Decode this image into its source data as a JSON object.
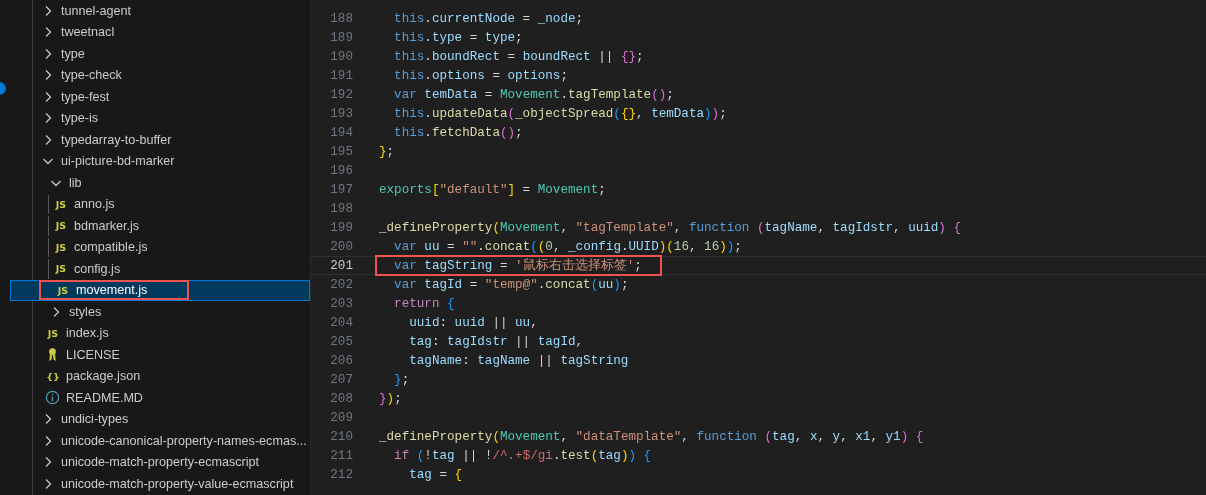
{
  "sidebar": {
    "tree": [
      {
        "label": "tunnel-agent",
        "kind": "folder",
        "expanded": false,
        "selected": false,
        "marked": false
      },
      {
        "label": "tweetnacl",
        "kind": "folder",
        "expanded": false,
        "selected": false,
        "marked": false
      },
      {
        "label": "type",
        "kind": "folder",
        "expanded": false,
        "selected": false,
        "marked": false
      },
      {
        "label": "type-check",
        "kind": "folder",
        "expanded": false,
        "selected": false,
        "marked": false
      },
      {
        "label": "type-fest",
        "kind": "folder",
        "expanded": false,
        "selected": false,
        "marked": false
      },
      {
        "label": "type-is",
        "kind": "folder",
        "expanded": false,
        "selected": false,
        "marked": false
      },
      {
        "label": "typedarray-to-buffer",
        "kind": "folder",
        "expanded": false,
        "selected": false,
        "marked": false
      },
      {
        "label": "ui-picture-bd-marker",
        "kind": "folder",
        "expanded": true,
        "selected": false,
        "marked": false,
        "children": [
          {
            "label": "lib",
            "kind": "folder",
            "expanded": true,
            "selected": false,
            "marked": false,
            "children": [
              {
                "label": "anno.js",
                "kind": "js",
                "badge": "JS",
                "selected": false,
                "marked": false
              },
              {
                "label": "bdmarker.js",
                "kind": "js",
                "badge": "JS",
                "selected": false,
                "marked": false
              },
              {
                "label": "compatible.js",
                "kind": "js",
                "badge": "JS",
                "selected": false,
                "marked": false
              },
              {
                "label": "config.js",
                "kind": "js",
                "badge": "JS",
                "selected": false,
                "marked": false
              },
              {
                "label": "movement.js",
                "kind": "js",
                "badge": "JS",
                "selected": true,
                "marked": true
              }
            ]
          },
          {
            "label": "styles",
            "kind": "folder",
            "expanded": false,
            "selected": false,
            "marked": false
          },
          {
            "label": "index.js",
            "kind": "js",
            "badge": "JS",
            "selected": false,
            "marked": false
          },
          {
            "label": "LICENSE",
            "kind": "license",
            "selected": false,
            "marked": false
          },
          {
            "label": "package.json",
            "kind": "json",
            "badge": "{}",
            "selected": false,
            "marked": false
          },
          {
            "label": "README.MD",
            "kind": "info",
            "selected": false,
            "marked": false
          }
        ]
      },
      {
        "label": "undici-types",
        "kind": "folder",
        "expanded": false,
        "selected": false,
        "marked": false
      },
      {
        "label": "unicode-canonical-property-names-ecmas...",
        "kind": "folder",
        "expanded": false,
        "selected": false,
        "marked": false
      },
      {
        "label": "unicode-match-property-ecmascript",
        "kind": "folder",
        "expanded": false,
        "selected": false,
        "marked": false
      },
      {
        "label": "unicode-match-property-value-ecmascript",
        "kind": "folder",
        "expanded": false,
        "selected": false,
        "marked": false
      }
    ]
  },
  "editor": {
    "lines": [
      {
        "number": "188",
        "current": false,
        "tokens": [
          {
            "kind": "keyword",
            "text": "  this"
          },
          {
            "kind": "plain",
            "text": "."
          },
          {
            "kind": "variable",
            "text": "currentNode"
          },
          {
            "kind": "plain",
            "text": " = "
          },
          {
            "kind": "variable",
            "text": "_node"
          },
          {
            "kind": "plain",
            "text": ";"
          }
        ]
      },
      {
        "number": "189",
        "current": false,
        "tokens": [
          {
            "kind": "keyword",
            "text": "  this"
          },
          {
            "kind": "plain",
            "text": "."
          },
          {
            "kind": "variable",
            "text": "type"
          },
          {
            "kind": "plain",
            "text": " = "
          },
          {
            "kind": "variable",
            "text": "type"
          },
          {
            "kind": "plain",
            "text": ";"
          }
        ]
      },
      {
        "number": "190",
        "current": false,
        "tokens": [
          {
            "kind": "keyword",
            "text": "  this"
          },
          {
            "kind": "plain",
            "text": "."
          },
          {
            "kind": "variable",
            "text": "boundRect"
          },
          {
            "kind": "plain",
            "text": " = "
          },
          {
            "kind": "variable",
            "text": "boundRect"
          },
          {
            "kind": "plain",
            "text": " || "
          },
          {
            "kind": "bracket2",
            "text": "{}"
          },
          {
            "kind": "plain",
            "text": ";"
          }
        ]
      },
      {
        "number": "191",
        "current": false,
        "tokens": [
          {
            "kind": "keyword",
            "text": "  this"
          },
          {
            "kind": "plain",
            "text": "."
          },
          {
            "kind": "variable",
            "text": "options"
          },
          {
            "kind": "plain",
            "text": " = "
          },
          {
            "kind": "variable",
            "text": "options"
          },
          {
            "kind": "plain",
            "text": ";"
          }
        ]
      },
      {
        "number": "192",
        "current": false,
        "tokens": [
          {
            "kind": "keyword",
            "text": "  var "
          },
          {
            "kind": "variable",
            "text": "temData"
          },
          {
            "kind": "plain",
            "text": " = "
          },
          {
            "kind": "class",
            "text": "Movement"
          },
          {
            "kind": "plain",
            "text": "."
          },
          {
            "kind": "function",
            "text": "tagTemplate"
          },
          {
            "kind": "bracket2",
            "text": "()"
          },
          {
            "kind": "plain",
            "text": ";"
          }
        ]
      },
      {
        "number": "193",
        "current": false,
        "tokens": [
          {
            "kind": "keyword",
            "text": "  this"
          },
          {
            "kind": "plain",
            "text": "."
          },
          {
            "kind": "function",
            "text": "updateData"
          },
          {
            "kind": "bracket2",
            "text": "("
          },
          {
            "kind": "function",
            "text": "_objectSpread"
          },
          {
            "kind": "bracket3",
            "text": "("
          },
          {
            "kind": "bracket1",
            "text": "{}"
          },
          {
            "kind": "plain",
            "text": ", "
          },
          {
            "kind": "variable",
            "text": "temData"
          },
          {
            "kind": "bracket3",
            "text": ")"
          },
          {
            "kind": "bracket2",
            "text": ")"
          },
          {
            "kind": "plain",
            "text": ";"
          }
        ]
      },
      {
        "number": "194",
        "current": false,
        "tokens": [
          {
            "kind": "keyword",
            "text": "  this"
          },
          {
            "kind": "plain",
            "text": "."
          },
          {
            "kind": "function",
            "text": "fetchData"
          },
          {
            "kind": "bracket2",
            "text": "()"
          },
          {
            "kind": "plain",
            "text": ";"
          }
        ]
      },
      {
        "number": "195",
        "current": false,
        "tokens": [
          {
            "kind": "bracket1",
            "text": "}"
          },
          {
            "kind": "plain",
            "text": ";"
          }
        ]
      },
      {
        "number": "196",
        "current": false
      },
      {
        "number": "197",
        "current": false,
        "tokens": [
          {
            "kind": "class",
            "text": "exports"
          },
          {
            "kind": "bracket1",
            "text": "["
          },
          {
            "kind": "string",
            "text": "\"default\""
          },
          {
            "kind": "bracket1",
            "text": "]"
          },
          {
            "kind": "plain",
            "text": " = "
          },
          {
            "kind": "class",
            "text": "Movement"
          },
          {
            "kind": "plain",
            "text": ";"
          }
        ]
      },
      {
        "number": "198",
        "current": false
      },
      {
        "number": "199",
        "current": false,
        "tokens": [
          {
            "kind": "function",
            "text": "_defineProperty"
          },
          {
            "kind": "bracket1",
            "text": "("
          },
          {
            "kind": "class",
            "text": "Movement"
          },
          {
            "kind": "plain",
            "text": ", "
          },
          {
            "kind": "string",
            "text": "\"tagTemplate\""
          },
          {
            "kind": "plain",
            "text": ", "
          },
          {
            "kind": "keyword",
            "text": "function "
          },
          {
            "kind": "bracket2",
            "text": "("
          },
          {
            "kind": "variable",
            "text": "tagName"
          },
          {
            "kind": "plain",
            "text": ", "
          },
          {
            "kind": "variable",
            "text": "tagIdstr"
          },
          {
            "kind": "plain",
            "text": ", "
          },
          {
            "kind": "variable",
            "text": "uuid"
          },
          {
            "kind": "bracket2",
            "text": ") {"
          }
        ]
      },
      {
        "number": "200",
        "current": false,
        "tokens": [
          {
            "kind": "keyword",
            "text": "  var "
          },
          {
            "kind": "variable",
            "text": "uu"
          },
          {
            "kind": "plain",
            "text": " = "
          },
          {
            "kind": "string",
            "text": "\"\""
          },
          {
            "kind": "plain",
            "text": "."
          },
          {
            "kind": "function",
            "text": "concat"
          },
          {
            "kind": "bracket3",
            "text": "("
          },
          {
            "kind": "bracket1",
            "text": "("
          },
          {
            "kind": "number",
            "text": "0"
          },
          {
            "kind": "plain",
            "text": ", "
          },
          {
            "kind": "variable",
            "text": "_config"
          },
          {
            "kind": "plain",
            "text": "."
          },
          {
            "kind": "variable",
            "text": "UUID"
          },
          {
            "kind": "bracket1",
            "text": ")("
          },
          {
            "kind": "number",
            "text": "16"
          },
          {
            "kind": "plain",
            "text": ", "
          },
          {
            "kind": "number",
            "text": "16"
          },
          {
            "kind": "bracket1",
            "text": ")"
          },
          {
            "kind": "bracket3",
            "text": ")"
          },
          {
            "kind": "plain",
            "text": ";"
          }
        ]
      },
      {
        "number": "201",
        "current": true,
        "marked": true,
        "tokens": [
          {
            "kind": "keyword",
            "text": "  var "
          },
          {
            "kind": "variable",
            "text": "tagString"
          },
          {
            "kind": "plain",
            "text": " = "
          },
          {
            "kind": "string",
            "text": "'鼠标右击选择标签'"
          },
          {
            "kind": "plain",
            "text": ";"
          }
        ]
      },
      {
        "number": "202",
        "current": false,
        "tokens": [
          {
            "kind": "keyword",
            "text": "  var "
          },
          {
            "kind": "variable",
            "text": "tagId"
          },
          {
            "kind": "plain",
            "text": " = "
          },
          {
            "kind": "string",
            "text": "\"temp@\""
          },
          {
            "kind": "plain",
            "text": "."
          },
          {
            "kind": "function",
            "text": "concat"
          },
          {
            "kind": "bracket3",
            "text": "("
          },
          {
            "kind": "variable",
            "text": "uu"
          },
          {
            "kind": "bracket3",
            "text": ")"
          },
          {
            "kind": "plain",
            "text": ";"
          }
        ]
      },
      {
        "number": "203",
        "current": false,
        "tokens": [
          {
            "kind": "control",
            "text": "  return "
          },
          {
            "kind": "bracket3",
            "text": "{"
          }
        ]
      },
      {
        "number": "204",
        "current": false,
        "tokens": [
          {
            "kind": "variable",
            "text": "    uuid"
          },
          {
            "kind": "plain",
            "text": ": "
          },
          {
            "kind": "variable",
            "text": "uuid"
          },
          {
            "kind": "plain",
            "text": " || "
          },
          {
            "kind": "variable",
            "text": "uu"
          },
          {
            "kind": "plain",
            "text": ","
          }
        ]
      },
      {
        "number": "205",
        "current": false,
        "tokens": [
          {
            "kind": "variable",
            "text": "    tag"
          },
          {
            "kind": "plain",
            "text": ": "
          },
          {
            "kind": "variable",
            "text": "tagIdstr"
          },
          {
            "kind": "plain",
            "text": " || "
          },
          {
            "kind": "variable",
            "text": "tagId"
          },
          {
            "kind": "plain",
            "text": ","
          }
        ]
      },
      {
        "number": "206",
        "current": false,
        "tokens": [
          {
            "kind": "variable",
            "text": "    tagName"
          },
          {
            "kind": "plain",
            "text": ": "
          },
          {
            "kind": "variable",
            "text": "tagName"
          },
          {
            "kind": "plain",
            "text": " || "
          },
          {
            "kind": "variable",
            "text": "tagString"
          }
        ]
      },
      {
        "number": "207",
        "current": false,
        "tokens": [
          {
            "kind": "bracket3",
            "text": "  }"
          },
          {
            "kind": "plain",
            "text": ";"
          }
        ]
      },
      {
        "number": "208",
        "current": false,
        "tokens": [
          {
            "kind": "bracket2",
            "text": "}"
          },
          {
            "kind": "bracket1",
            "text": ")"
          },
          {
            "kind": "plain",
            "text": ";"
          }
        ]
      },
      {
        "number": "209",
        "current": false
      },
      {
        "number": "210",
        "current": false,
        "tokens": [
          {
            "kind": "function",
            "text": "_defineProperty"
          },
          {
            "kind": "bracket1",
            "text": "("
          },
          {
            "kind": "class",
            "text": "Movement"
          },
          {
            "kind": "plain",
            "text": ", "
          },
          {
            "kind": "string",
            "text": "\"dataTemplate\""
          },
          {
            "kind": "plain",
            "text": ", "
          },
          {
            "kind": "keyword",
            "text": "function "
          },
          {
            "kind": "bracket2",
            "text": "("
          },
          {
            "kind": "variable",
            "text": "tag"
          },
          {
            "kind": "plain",
            "text": ", "
          },
          {
            "kind": "variable",
            "text": "x"
          },
          {
            "kind": "plain",
            "text": ", "
          },
          {
            "kind": "variable",
            "text": "y"
          },
          {
            "kind": "plain",
            "text": ", "
          },
          {
            "kind": "variable",
            "text": "x1"
          },
          {
            "kind": "plain",
            "text": ", "
          },
          {
            "kind": "variable",
            "text": "y1"
          },
          {
            "kind": "bracket2",
            "text": ") {"
          }
        ]
      },
      {
        "number": "211",
        "current": false,
        "tokens": [
          {
            "kind": "control",
            "text": "  if "
          },
          {
            "kind": "bracket3",
            "text": "("
          },
          {
            "kind": "plain",
            "text": "!"
          },
          {
            "kind": "variable",
            "text": "tag"
          },
          {
            "kind": "plain",
            "text": " || !"
          },
          {
            "kind": "regex",
            "text": "/^.+$/gi"
          },
          {
            "kind": "plain",
            "text": "."
          },
          {
            "kind": "function",
            "text": "test"
          },
          {
            "kind": "bracket1",
            "text": "("
          },
          {
            "kind": "variable",
            "text": "tag"
          },
          {
            "kind": "bracket1",
            "text": ")"
          },
          {
            "kind": "bracket3",
            "text": ") {"
          }
        ]
      },
      {
        "number": "212",
        "current": false,
        "tokens": [
          {
            "kind": "variable",
            "text": "    tag"
          },
          {
            "kind": "plain",
            "text": " = "
          },
          {
            "kind": "bracket1",
            "text": "{"
          }
        ]
      }
    ]
  }
}
